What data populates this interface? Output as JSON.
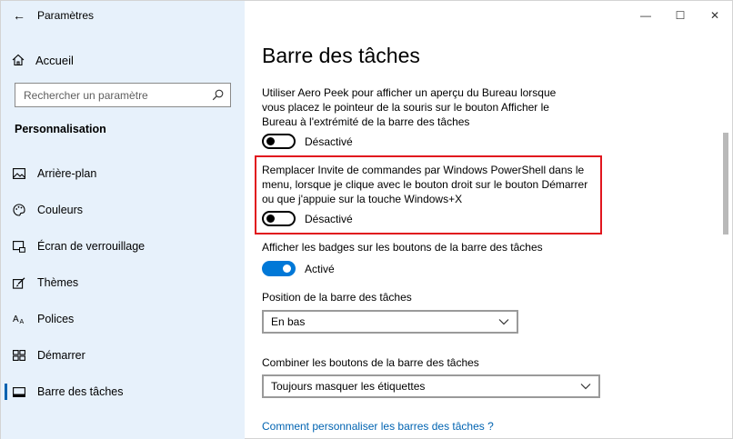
{
  "window": {
    "title": "Paramètres",
    "back_glyph": "←",
    "controls": {
      "minimize": "—",
      "maximize": "☐",
      "close": "✕"
    }
  },
  "sidebar": {
    "home": {
      "label": "Accueil",
      "icon": "home-icon"
    },
    "search": {
      "placeholder": "Rechercher un paramètre"
    },
    "section_title": "Personnalisation",
    "items": [
      {
        "label": "Arrière-plan",
        "icon": "image-icon"
      },
      {
        "label": "Couleurs",
        "icon": "palette-icon"
      },
      {
        "label": "Écran de verrouillage",
        "icon": "lock-screen-icon"
      },
      {
        "label": "Thèmes",
        "icon": "brush-icon"
      },
      {
        "label": "Polices",
        "icon": "font-icon"
      },
      {
        "label": "Démarrer",
        "icon": "start-icon"
      },
      {
        "label": "Barre des tâches",
        "icon": "taskbar-icon",
        "active": true
      }
    ]
  },
  "main": {
    "title": "Barre des tâches",
    "settings": [
      {
        "description": "Utiliser Aero Peek pour afficher un aperçu du Bureau lorsque vous placez le pointeur de la souris sur le bouton Afficher le Bureau à l'extrémité de la barre des tâches",
        "state": "Désactivé",
        "on": false
      },
      {
        "description": "Remplacer Invite de commandes par Windows PowerShell dans le menu, lorsque je clique avec le bouton droit sur le bouton Démarrer ou que j'appuie sur la touche Windows+X",
        "state": "Désactivé",
        "on": false
      },
      {
        "description": "Afficher les badges sur les boutons de la barre des tâches",
        "state": "Activé",
        "on": true
      }
    ],
    "position": {
      "label": "Position de la barre des tâches",
      "value": "En bas"
    },
    "combine": {
      "label": "Combiner les boutons de la barre des tâches",
      "value": "Toujours masquer les étiquettes"
    },
    "help_link": "Comment personnaliser les barres des tâches ?"
  },
  "colors": {
    "accent": "#0078d7",
    "sidebar_bg": "#e7f1fb",
    "highlight": "#e1161e",
    "link": "#0063b1"
  }
}
